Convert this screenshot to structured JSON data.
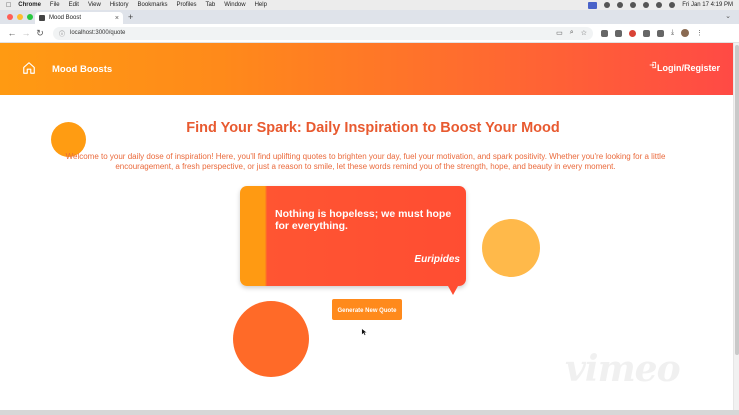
{
  "menubar": {
    "app": "Chrome",
    "items": [
      "File",
      "Edit",
      "View",
      "History",
      "Bookmarks",
      "Profiles",
      "Tab",
      "Window",
      "Help"
    ],
    "datetime": "Fri Jan 17  4:19 PM"
  },
  "browser": {
    "tab_title": "Mood Boost",
    "url": "localhost:3000/quote"
  },
  "header": {
    "brand": "Mood Boosts",
    "login": "Login/Register",
    "gradient": [
      "#ff9a12",
      "#ff4a45"
    ]
  },
  "main": {
    "title": "Find Your Spark: Daily Inspiration to Boost Your Mood",
    "intro": "Welcome to your daily dose of inspiration! Here, you'll find uplifting quotes to brighten your day, fuel your motivation, and spark positivity. Whether you're looking for a little encouragement, a fresh perspective, or just a reason to smile, let these words remind you of the strength, hope, and beauty in every moment.",
    "quote": {
      "text": "Nothing is hopeless; we must hope for everything.",
      "author": "Euripides"
    },
    "generate_button": "Generate New Quote"
  },
  "watermark": "vimeo",
  "colors": {
    "accent": "#e85a30",
    "card": "#ff4d32",
    "button": "#ff8a1c"
  }
}
